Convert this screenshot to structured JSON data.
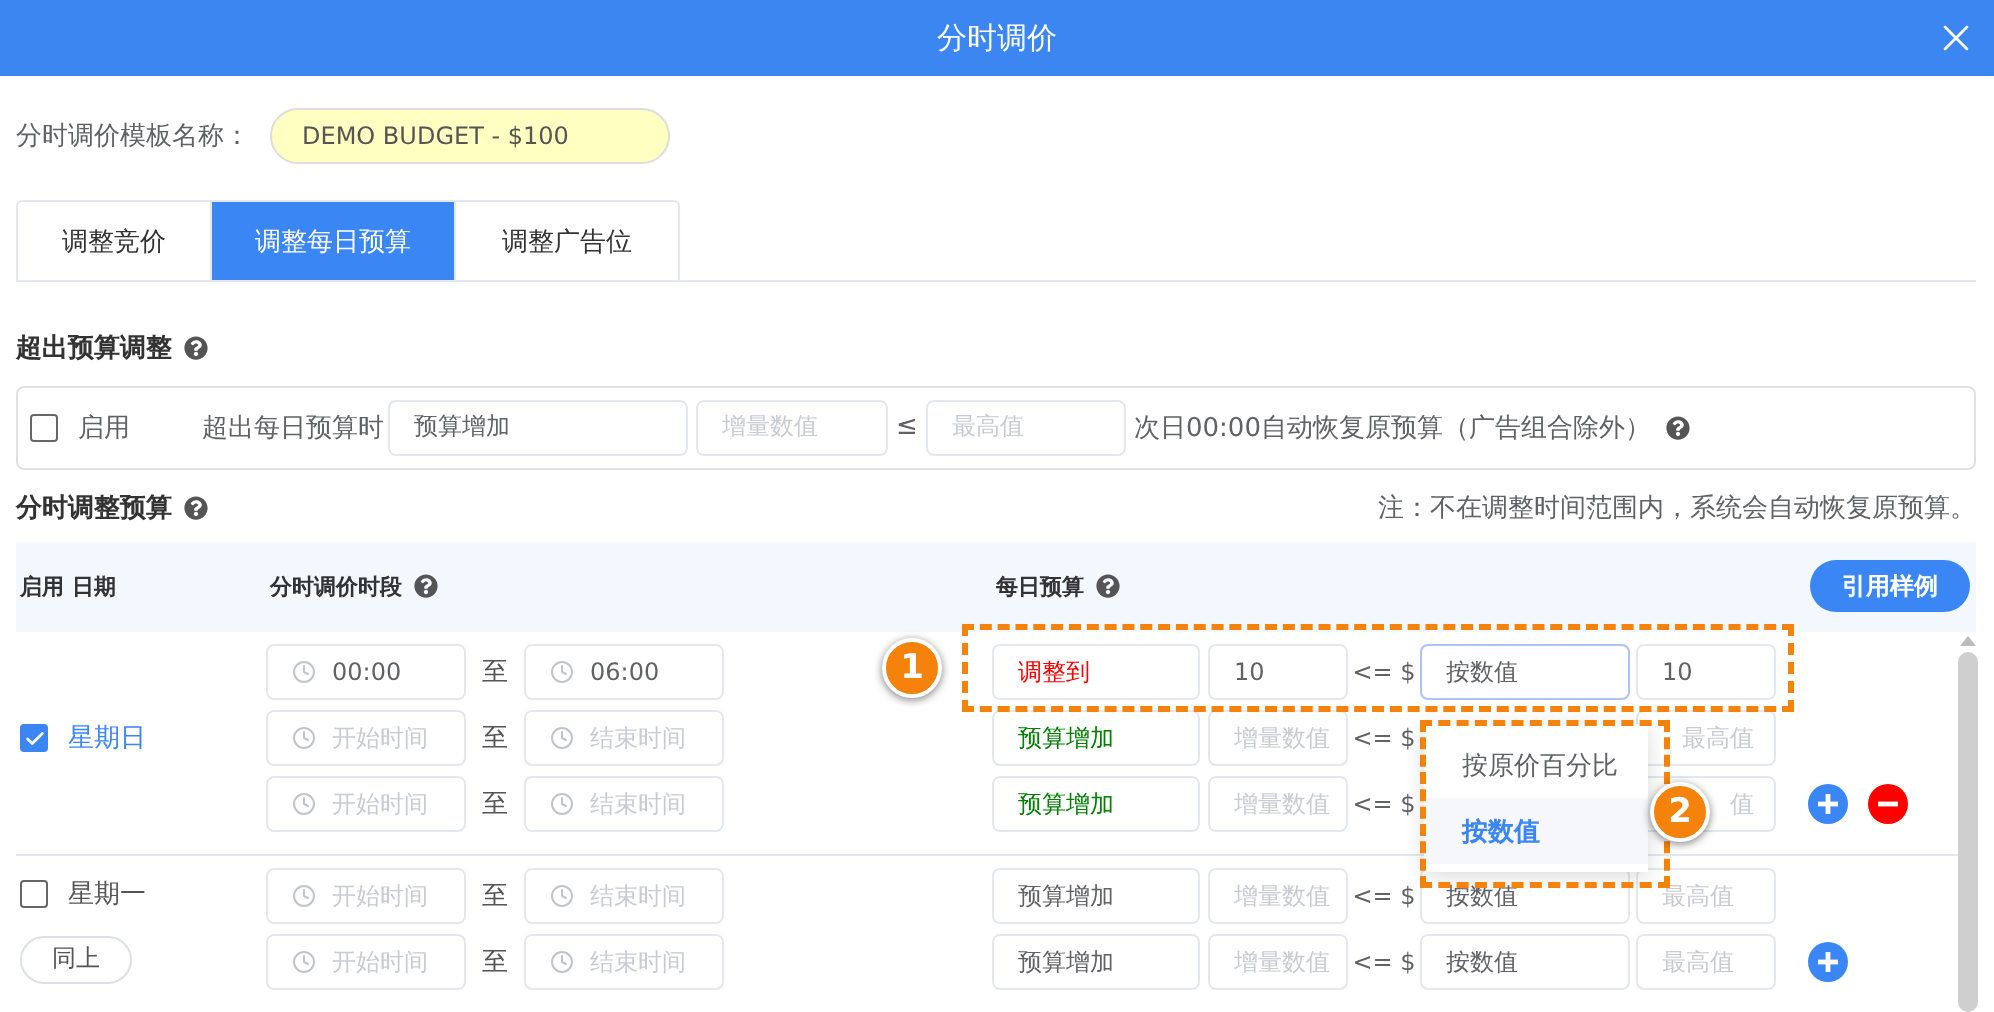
{
  "window": {
    "title": "分时调价"
  },
  "template": {
    "label": "分时调价模板名称：",
    "name": "DEMO BUDGET - $100"
  },
  "tabs": [
    {
      "label": "调整竞价",
      "selected": false
    },
    {
      "label": "调整每日预算",
      "selected": true
    },
    {
      "label": "调整广告位",
      "selected": false
    }
  ],
  "over_budget": {
    "title": "超出预算调整",
    "enabled": {
      "label": "启用",
      "checked": false
    },
    "condition": "超出每日预算时",
    "action": {
      "value": "预算增加"
    },
    "amount": {
      "placeholder": "增量数值"
    },
    "operator": "≤",
    "max": {
      "placeholder": "最高值"
    },
    "note": "次日00:00自动恢复原预算（广告组合除外）"
  },
  "schedule": {
    "title": "分时调整预算",
    "note": "注：不在调整时间范围内，系统会自动恢复原预算。",
    "columns": [
      {
        "label": "启用 日期",
        "help": false
      },
      {
        "label": "分时调价时段",
        "help": true
      },
      {
        "label": "每日预算",
        "help": true
      }
    ],
    "sample_button": "引用样例",
    "days": [
      {
        "day": "星期日",
        "checked": true,
        "slots": [
          {
            "start": {
              "value": "00:00"
            },
            "to": "至",
            "end": {
              "value": "06:00"
            },
            "action": {
              "value": "调整到",
              "color": "#ff0000"
            },
            "amount": {
              "value": "10"
            },
            "op": "<= $",
            "mode": {
              "value": "按数值",
              "focused": true
            },
            "max": {
              "value": "10"
            },
            "add": false,
            "remove": false
          },
          {
            "start": {
              "placeholder": "开始时间"
            },
            "to": "至",
            "end": {
              "placeholder": "结束时间"
            },
            "action": {
              "value": "预算增加",
              "color": "#008000"
            },
            "amount": {
              "placeholder": "增量数值"
            },
            "op": "<= $",
            "max": {
              "placeholder": "最高值"
            },
            "add": false,
            "remove": false
          },
          {
            "start": {
              "placeholder": "开始时间"
            },
            "to": "至",
            "end": {
              "placeholder": "结束时间"
            },
            "action": {
              "value": "预算增加",
              "color": "#008000"
            },
            "amount": {
              "placeholder": "增量数值"
            },
            "op": "<= $",
            "max": {
              "placeholder": "值"
            },
            "add": true,
            "remove": true
          }
        ]
      },
      {
        "day": "星期一",
        "checked": false,
        "copy_button": "同上",
        "slots": [
          {
            "start": {
              "placeholder": "开始时间"
            },
            "to": "至",
            "end": {
              "placeholder": "结束时间"
            },
            "action": {
              "value": "预算增加",
              "color": "#606266"
            },
            "amount": {
              "placeholder": "增量数值"
            },
            "op": "<= $",
            "mode": {
              "value": "按数值",
              "focused": false
            },
            "max": {
              "placeholder": "最高值"
            },
            "add": false,
            "remove": false
          },
          {
            "start": {
              "placeholder": "开始时间"
            },
            "to": "至",
            "end": {
              "placeholder": "结束时间"
            },
            "action": {
              "value": "预算增加",
              "color": "#606266"
            },
            "amount": {
              "placeholder": "增量数值"
            },
            "op": "<= $",
            "mode": {
              "value": "按数值",
              "focused": false
            },
            "max": {
              "placeholder": "最高值"
            },
            "add": true,
            "remove": false
          }
        ]
      }
    ]
  },
  "dropdown": {
    "options": [
      {
        "label": "按原价百分比",
        "selected": false
      },
      {
        "label": "按数值",
        "selected": true
      }
    ]
  },
  "callouts": [
    {
      "label": "1"
    },
    {
      "label": "2"
    }
  ]
}
